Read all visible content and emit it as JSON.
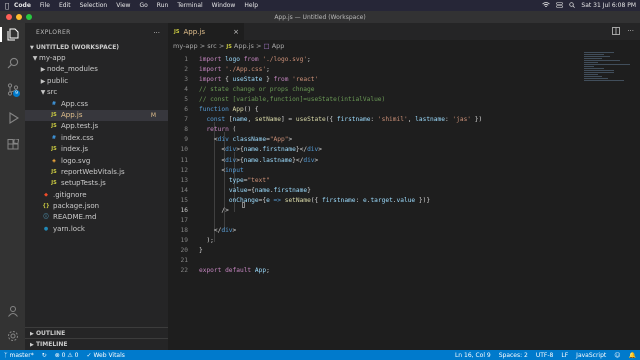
{
  "menubar": {
    "app": "Code",
    "items": [
      "File",
      "Edit",
      "Selection",
      "View",
      "Go",
      "Run",
      "Terminal",
      "Window",
      "Help"
    ],
    "clock": "Sat 31 Jul  6:08 PM"
  },
  "window": {
    "title": "App.js — Untitled (Workspace)"
  },
  "sidebar": {
    "title": "EXPLORER",
    "workspace": "UNTITLED (WORKSPACE)",
    "tree": [
      {
        "label": "my-app",
        "type": "folder-open",
        "depth": 1
      },
      {
        "label": "node_modules",
        "type": "folder",
        "depth": 2
      },
      {
        "label": "public",
        "type": "folder",
        "depth": 2
      },
      {
        "label": "src",
        "type": "folder-open",
        "depth": 2
      },
      {
        "label": "App.css",
        "type": "css",
        "depth": 3
      },
      {
        "label": "App.js",
        "type": "js",
        "depth": 3,
        "selected": true,
        "badge": "M"
      },
      {
        "label": "App.test.js",
        "type": "js",
        "depth": 3
      },
      {
        "label": "index.css",
        "type": "css",
        "depth": 3
      },
      {
        "label": "index.js",
        "type": "js",
        "depth": 3
      },
      {
        "label": "logo.svg",
        "type": "svg",
        "depth": 3
      },
      {
        "label": "reportWebVitals.js",
        "type": "js",
        "depth": 3
      },
      {
        "label": "setupTests.js",
        "type": "js",
        "depth": 3
      },
      {
        "label": ".gitignore",
        "type": "git",
        "depth": 2
      },
      {
        "label": "package.json",
        "type": "json",
        "depth": 2
      },
      {
        "label": "README.md",
        "type": "md",
        "depth": 2
      },
      {
        "label": "yarn.lock",
        "type": "lock",
        "depth": 2
      }
    ],
    "outline": "OUTLINE",
    "timeline": "TIMELINE"
  },
  "editor": {
    "tab": {
      "icon": "JS",
      "label": "App.js",
      "close": "×"
    },
    "breadcrumb": {
      "folder": "my-app",
      "sep": ">",
      "sub": "src",
      "file_icon": "JS",
      "file": "App.js",
      "symbol": "App"
    },
    "lines": [
      {
        "n": "1",
        "segs": [
          [
            "kw",
            "import "
          ],
          [
            "vr",
            "logo"
          ],
          [
            "kw",
            " from "
          ],
          [
            "st",
            "'./logo.svg'"
          ],
          [
            "pn",
            ";"
          ]
        ]
      },
      {
        "n": "2",
        "segs": [
          [
            "kw",
            "import "
          ],
          [
            "st",
            "'./App.css'"
          ],
          [
            "pn",
            ";"
          ]
        ]
      },
      {
        "n": "3",
        "segs": [
          [
            "kw",
            "import "
          ],
          [
            "pn",
            "{ "
          ],
          [
            "vr",
            "useState"
          ],
          [
            "pn",
            " } "
          ],
          [
            "kw",
            "from "
          ],
          [
            "st",
            "'react'"
          ]
        ]
      },
      {
        "n": "4",
        "segs": [
          [
            "cm",
            "// state change or props chnage"
          ]
        ]
      },
      {
        "n": "5",
        "segs": [
          [
            "cm",
            "// const [variable,function]=useState(intialValue)"
          ]
        ]
      },
      {
        "n": "6",
        "segs": [
          [
            "kb",
            "function "
          ],
          [
            "fn",
            "App"
          ],
          [
            "pn",
            "() {"
          ]
        ]
      },
      {
        "n": "7",
        "segs": [
          [
            "pn",
            "  "
          ],
          [
            "kb",
            "const "
          ],
          [
            "pn",
            "["
          ],
          [
            "vr",
            "name"
          ],
          [
            "pn",
            ", "
          ],
          [
            "fn",
            "setName"
          ],
          [
            "pn",
            "] = "
          ],
          [
            "fn",
            "useState"
          ],
          [
            "pn",
            "({ "
          ],
          [
            "vr",
            "firstname"
          ],
          [
            "pn",
            ": "
          ],
          [
            "st",
            "'shimil'"
          ],
          [
            "pn",
            ", "
          ],
          [
            "vr",
            "lastname"
          ],
          [
            "pn",
            ": "
          ],
          [
            "st",
            "'jas'"
          ],
          [
            "pn",
            " })"
          ]
        ]
      },
      {
        "n": "8",
        "segs": [
          [
            "pn",
            "  "
          ],
          [
            "kw",
            "return "
          ],
          [
            "pn",
            "("
          ]
        ]
      },
      {
        "n": "9",
        "segs": [
          [
            "pn",
            "    <"
          ],
          [
            "tg",
            "div "
          ],
          [
            "at",
            "className"
          ],
          [
            "pn",
            "="
          ],
          [
            "st",
            "\"App\""
          ],
          [
            "pn",
            ">"
          ]
        ]
      },
      {
        "n": "10",
        "segs": [
          [
            "pn",
            "      <"
          ],
          [
            "tg",
            "div"
          ],
          [
            "pn",
            ">{"
          ],
          [
            "vr",
            "name"
          ],
          [
            "pn",
            "."
          ],
          [
            "vr",
            "firstname"
          ],
          [
            "pn",
            "}</"
          ],
          [
            "tg",
            "div"
          ],
          [
            "pn",
            ">"
          ]
        ]
      },
      {
        "n": "11",
        "segs": [
          [
            "pn",
            "      <"
          ],
          [
            "tg",
            "div"
          ],
          [
            "pn",
            ">{"
          ],
          [
            "vr",
            "name"
          ],
          [
            "pn",
            "."
          ],
          [
            "vr",
            "lastname"
          ],
          [
            "pn",
            "}</"
          ],
          [
            "tg",
            "div"
          ],
          [
            "pn",
            ">"
          ]
        ]
      },
      {
        "n": "12",
        "segs": [
          [
            "pn",
            "      <"
          ],
          [
            "tg",
            "input"
          ]
        ]
      },
      {
        "n": "13",
        "segs": [
          [
            "pn",
            "        "
          ],
          [
            "at",
            "type"
          ],
          [
            "pn",
            "="
          ],
          [
            "st",
            "\"text\""
          ]
        ]
      },
      {
        "n": "14",
        "segs": [
          [
            "pn",
            "        "
          ],
          [
            "at",
            "value"
          ],
          [
            "pn",
            "={"
          ],
          [
            "vr",
            "name"
          ],
          [
            "pn",
            "."
          ],
          [
            "vr",
            "firstname"
          ],
          [
            "pn",
            "}"
          ]
        ]
      },
      {
        "n": "15",
        "segs": [
          [
            "pn",
            "        "
          ],
          [
            "at",
            "onChange"
          ],
          [
            "pn",
            "={"
          ],
          [
            "vr",
            "e"
          ],
          [
            "kb",
            " => "
          ],
          [
            "fn",
            "setName"
          ],
          [
            "pn",
            "({ "
          ],
          [
            "vr",
            "firstname"
          ],
          [
            "pn",
            ": "
          ],
          [
            "vr",
            "e"
          ],
          [
            "pn",
            "."
          ],
          [
            "vr",
            "target"
          ],
          [
            "pn",
            "."
          ],
          [
            "vr",
            "value"
          ],
          [
            "pn",
            " })}"
          ]
        ]
      },
      {
        "n": "16",
        "segs": [
          [
            "pn",
            "      />"
          ]
        ],
        "current": true
      },
      {
        "n": "17",
        "segs": [
          [
            "pn",
            ""
          ]
        ]
      },
      {
        "n": "18",
        "segs": [
          [
            "pn",
            "    </"
          ],
          [
            "tg",
            "div"
          ],
          [
            "pn",
            ">"
          ]
        ]
      },
      {
        "n": "19",
        "segs": [
          [
            "pn",
            "  );"
          ]
        ]
      },
      {
        "n": "20",
        "segs": [
          [
            "pn",
            "}"
          ]
        ]
      },
      {
        "n": "21",
        "segs": [
          [
            "pn",
            ""
          ]
        ]
      },
      {
        "n": "22",
        "segs": [
          [
            "kw",
            "export default "
          ],
          [
            "vr",
            "App"
          ],
          [
            "pn",
            ";"
          ]
        ]
      }
    ]
  },
  "statusbar": {
    "branch": "master*",
    "problems": "⊗ 0 ⚠ 0",
    "vitals": "Web Vitals",
    "position": "Ln 16, Col 9",
    "spaces": "Spaces: 2",
    "encoding": "UTF-8",
    "eol": "LF",
    "language": "JavaScript",
    "accent": "#007acc"
  }
}
